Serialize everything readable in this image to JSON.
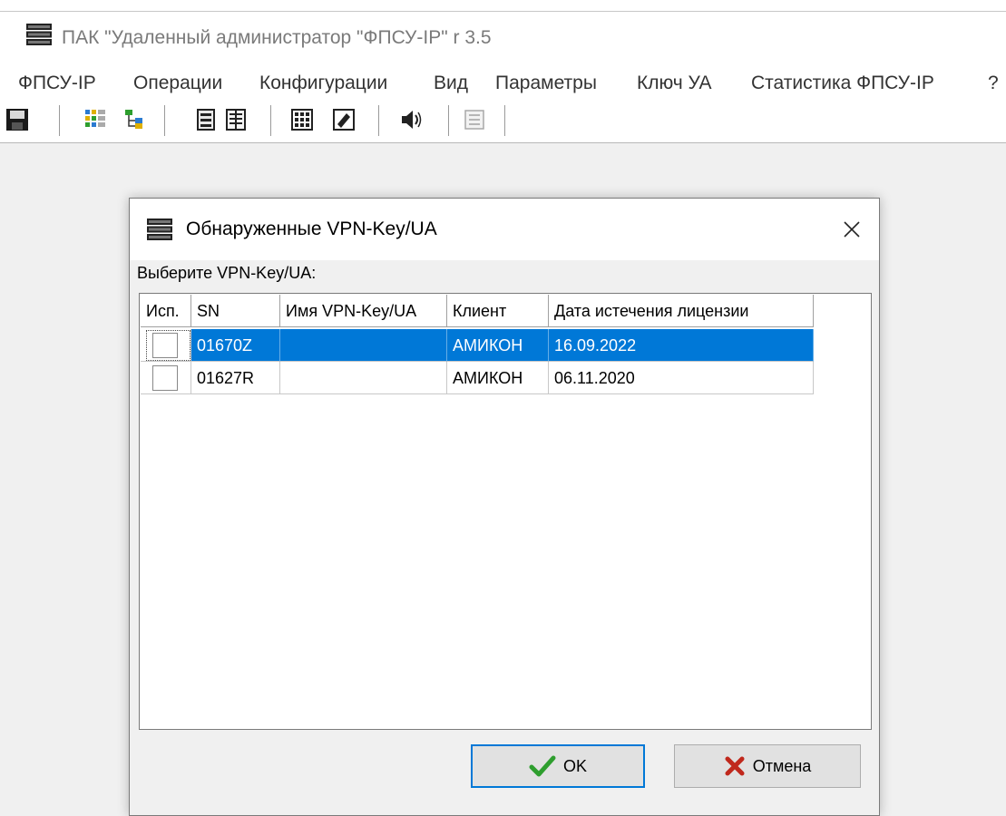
{
  "window": {
    "title": "ПАК \"Удаленный администратор \"ФПСУ-IP\" r 3.5",
    "icon": "server-rack-icon"
  },
  "menu": [
    {
      "label": "ФПСУ-IP"
    },
    {
      "label": "Операции"
    },
    {
      "label": "Конфигурации"
    },
    {
      "label": "Вид"
    },
    {
      "label": "Параметры"
    },
    {
      "label": "Ключ УА"
    },
    {
      "label": "Статистика ФПСУ-IP"
    },
    {
      "label": "?"
    }
  ],
  "toolbar": [
    {
      "icon": "save-icon"
    },
    {
      "icon": "grid-view-icon"
    },
    {
      "icon": "tree-view-icon"
    },
    {
      "icon": "device-icon"
    },
    {
      "icon": "device-list-icon"
    },
    {
      "icon": "keypad-icon"
    },
    {
      "icon": "edit-document-icon"
    },
    {
      "icon": "sound-icon"
    },
    {
      "icon": "disabled-panel-icon"
    }
  ],
  "dialog": {
    "title": "Обнаруженные VPN-Key/UA",
    "prompt": "Выберите VPN-Key/UA:",
    "columns": [
      "Исп.",
      "SN",
      "Имя VPN-Key/UA",
      "Клиент",
      "Дата истечения лицензии"
    ],
    "rows": [
      {
        "used": false,
        "sn": "01670Z",
        "name": "",
        "client": "АМИКОН",
        "expires": "16.09.2022",
        "selected": true
      },
      {
        "used": false,
        "sn": "01627R",
        "name": "",
        "client": "АМИКОН",
        "expires": "06.11.2020",
        "selected": false
      }
    ],
    "ok_label": "OK",
    "cancel_label": "Отмена"
  },
  "colors": {
    "selection": "#0078d7",
    "ok_check": "#2e9e2e",
    "cancel_x": "#c0281c"
  }
}
